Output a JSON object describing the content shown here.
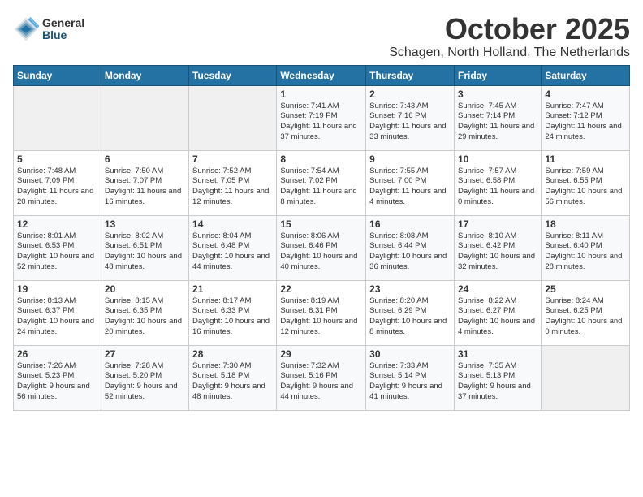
{
  "logo": {
    "general": "General",
    "blue": "Blue"
  },
  "title": "October 2025",
  "location": "Schagen, North Holland, The Netherlands",
  "days_of_week": [
    "Sunday",
    "Monday",
    "Tuesday",
    "Wednesday",
    "Thursday",
    "Friday",
    "Saturday"
  ],
  "weeks": [
    [
      {
        "day": "",
        "info": ""
      },
      {
        "day": "",
        "info": ""
      },
      {
        "day": "",
        "info": ""
      },
      {
        "day": "1",
        "info": "Sunrise: 7:41 AM\nSunset: 7:19 PM\nDaylight: 11 hours\nand 37 minutes."
      },
      {
        "day": "2",
        "info": "Sunrise: 7:43 AM\nSunset: 7:16 PM\nDaylight: 11 hours\nand 33 minutes."
      },
      {
        "day": "3",
        "info": "Sunrise: 7:45 AM\nSunset: 7:14 PM\nDaylight: 11 hours\nand 29 minutes."
      },
      {
        "day": "4",
        "info": "Sunrise: 7:47 AM\nSunset: 7:12 PM\nDaylight: 11 hours\nand 24 minutes."
      }
    ],
    [
      {
        "day": "5",
        "info": "Sunrise: 7:48 AM\nSunset: 7:09 PM\nDaylight: 11 hours\nand 20 minutes."
      },
      {
        "day": "6",
        "info": "Sunrise: 7:50 AM\nSunset: 7:07 PM\nDaylight: 11 hours\nand 16 minutes."
      },
      {
        "day": "7",
        "info": "Sunrise: 7:52 AM\nSunset: 7:05 PM\nDaylight: 11 hours\nand 12 minutes."
      },
      {
        "day": "8",
        "info": "Sunrise: 7:54 AM\nSunset: 7:02 PM\nDaylight: 11 hours\nand 8 minutes."
      },
      {
        "day": "9",
        "info": "Sunrise: 7:55 AM\nSunset: 7:00 PM\nDaylight: 11 hours\nand 4 minutes."
      },
      {
        "day": "10",
        "info": "Sunrise: 7:57 AM\nSunset: 6:58 PM\nDaylight: 11 hours\nand 0 minutes."
      },
      {
        "day": "11",
        "info": "Sunrise: 7:59 AM\nSunset: 6:55 PM\nDaylight: 10 hours\nand 56 minutes."
      }
    ],
    [
      {
        "day": "12",
        "info": "Sunrise: 8:01 AM\nSunset: 6:53 PM\nDaylight: 10 hours\nand 52 minutes."
      },
      {
        "day": "13",
        "info": "Sunrise: 8:02 AM\nSunset: 6:51 PM\nDaylight: 10 hours\nand 48 minutes."
      },
      {
        "day": "14",
        "info": "Sunrise: 8:04 AM\nSunset: 6:48 PM\nDaylight: 10 hours\nand 44 minutes."
      },
      {
        "day": "15",
        "info": "Sunrise: 8:06 AM\nSunset: 6:46 PM\nDaylight: 10 hours\nand 40 minutes."
      },
      {
        "day": "16",
        "info": "Sunrise: 8:08 AM\nSunset: 6:44 PM\nDaylight: 10 hours\nand 36 minutes."
      },
      {
        "day": "17",
        "info": "Sunrise: 8:10 AM\nSunset: 6:42 PM\nDaylight: 10 hours\nand 32 minutes."
      },
      {
        "day": "18",
        "info": "Sunrise: 8:11 AM\nSunset: 6:40 PM\nDaylight: 10 hours\nand 28 minutes."
      }
    ],
    [
      {
        "day": "19",
        "info": "Sunrise: 8:13 AM\nSunset: 6:37 PM\nDaylight: 10 hours\nand 24 minutes."
      },
      {
        "day": "20",
        "info": "Sunrise: 8:15 AM\nSunset: 6:35 PM\nDaylight: 10 hours\nand 20 minutes."
      },
      {
        "day": "21",
        "info": "Sunrise: 8:17 AM\nSunset: 6:33 PM\nDaylight: 10 hours\nand 16 minutes."
      },
      {
        "day": "22",
        "info": "Sunrise: 8:19 AM\nSunset: 6:31 PM\nDaylight: 10 hours\nand 12 minutes."
      },
      {
        "day": "23",
        "info": "Sunrise: 8:20 AM\nSunset: 6:29 PM\nDaylight: 10 hours\nand 8 minutes."
      },
      {
        "day": "24",
        "info": "Sunrise: 8:22 AM\nSunset: 6:27 PM\nDaylight: 10 hours\nand 4 minutes."
      },
      {
        "day": "25",
        "info": "Sunrise: 8:24 AM\nSunset: 6:25 PM\nDaylight: 10 hours\nand 0 minutes."
      }
    ],
    [
      {
        "day": "26",
        "info": "Sunrise: 7:26 AM\nSunset: 5:23 PM\nDaylight: 9 hours\nand 56 minutes."
      },
      {
        "day": "27",
        "info": "Sunrise: 7:28 AM\nSunset: 5:20 PM\nDaylight: 9 hours\nand 52 minutes."
      },
      {
        "day": "28",
        "info": "Sunrise: 7:30 AM\nSunset: 5:18 PM\nDaylight: 9 hours\nand 48 minutes."
      },
      {
        "day": "29",
        "info": "Sunrise: 7:32 AM\nSunset: 5:16 PM\nDaylight: 9 hours\nand 44 minutes."
      },
      {
        "day": "30",
        "info": "Sunrise: 7:33 AM\nSunset: 5:14 PM\nDaylight: 9 hours\nand 41 minutes."
      },
      {
        "day": "31",
        "info": "Sunrise: 7:35 AM\nSunset: 5:13 PM\nDaylight: 9 hours\nand 37 minutes."
      },
      {
        "day": "",
        "info": ""
      }
    ]
  ]
}
